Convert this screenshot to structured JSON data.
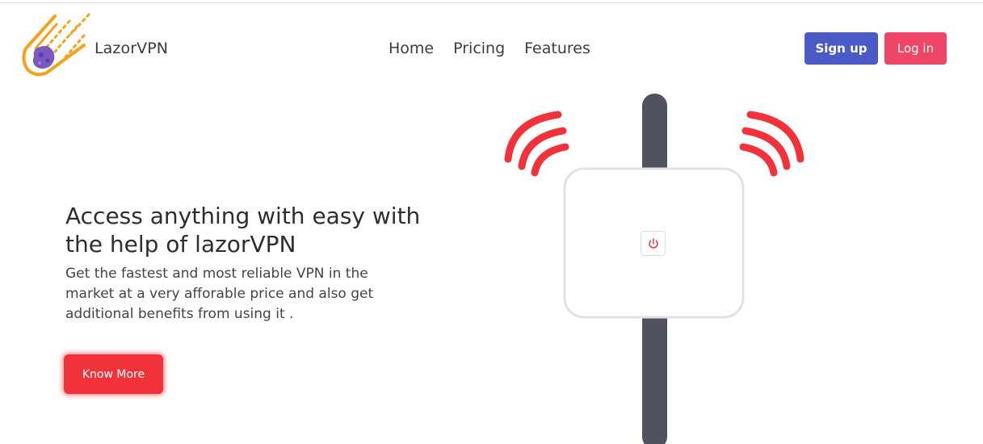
{
  "brand": {
    "name": "LazorVPN",
    "logo": "meteor-logo-icon"
  },
  "nav": {
    "items": [
      "Home",
      "Pricing",
      "Features"
    ]
  },
  "auth": {
    "signup_label": "Sign up",
    "login_label": "Log in"
  },
  "hero": {
    "title": "Access anything with easy with the help of lazorVPN",
    "subtitle": "Get the fastest and most reliable VPN in the market at a very afforable price and also get additional benefits from using it .",
    "cta_label": "Know More"
  },
  "illustration": {
    "device_icon": "router-icon",
    "signal_icon": "wifi-signal-icon",
    "power_icon": "power-icon"
  },
  "colors": {
    "primary": "#4a5bc8",
    "login": "#ef4566",
    "accent_red": "#f1323a",
    "pole": "#51525f",
    "logo_orange": "#f7a21c",
    "logo_purple": "#7b57c4"
  }
}
